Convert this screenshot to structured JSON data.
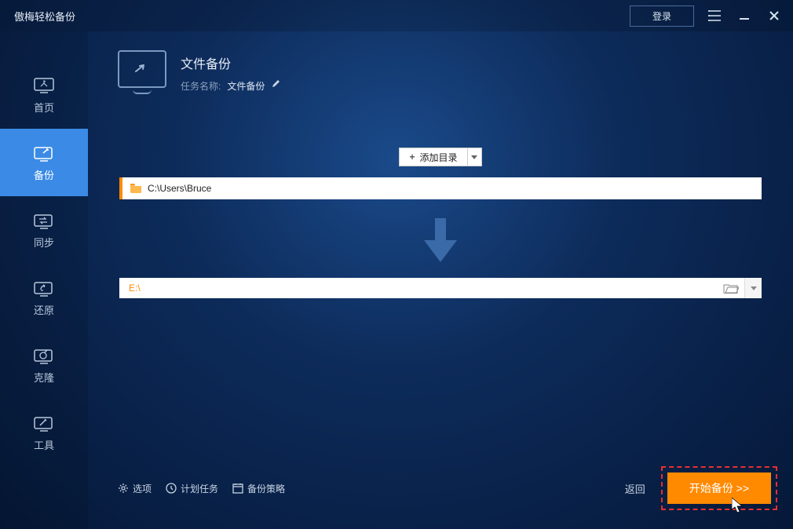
{
  "titlebar": {
    "app_title": "傲梅轻松备份",
    "login_label": "登录"
  },
  "sidebar": {
    "items": [
      {
        "label": "首页"
      },
      {
        "label": "备份"
      },
      {
        "label": "同步"
      },
      {
        "label": "还原"
      },
      {
        "label": "克隆"
      },
      {
        "label": "工具"
      }
    ]
  },
  "header": {
    "title": "文件备份",
    "task_label": "任务名称:",
    "task_name": "文件备份"
  },
  "add_dir": {
    "label": "添加目录"
  },
  "source": {
    "path": "C:\\Users\\Bruce"
  },
  "dest": {
    "path": "E:\\"
  },
  "footer": {
    "options": "选项",
    "schedule": "计划任务",
    "strategy": "备份策略",
    "back": "返回",
    "start": "开始备份 >>"
  }
}
